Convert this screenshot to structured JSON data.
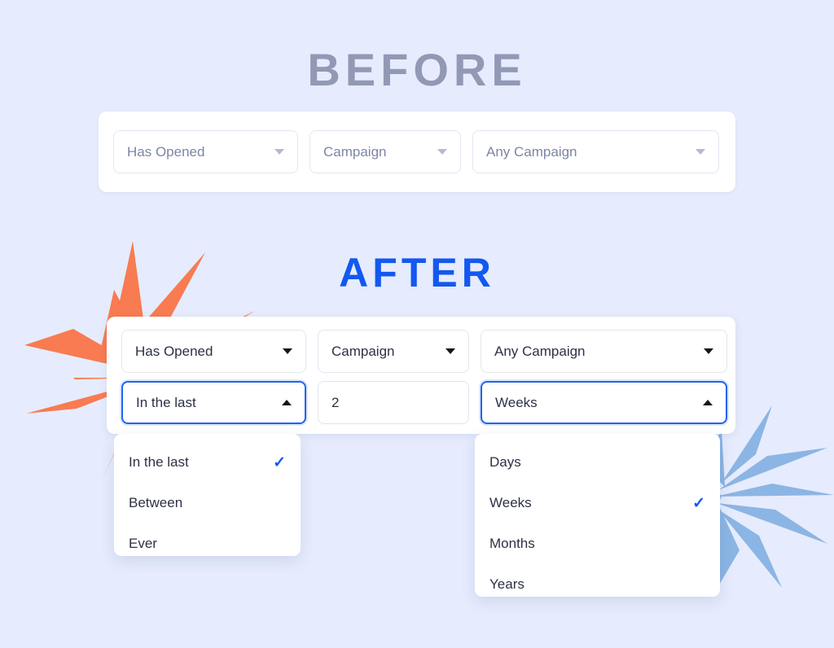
{
  "theme": {
    "background": "#e6ecfd",
    "before_title_color": "#9299b5",
    "after_title_color": "#1358f0",
    "accent_blue": "#2065e8",
    "burst_orange": "#f87b52",
    "burst_blue": "#8bb5e4",
    "card_white": "#ffffff"
  },
  "before": {
    "title": "BEFORE",
    "fields": [
      {
        "name": "event-type-select",
        "value": "Has Opened",
        "caret": "chevron-down-icon"
      },
      {
        "name": "campaign-type-select",
        "value": "Campaign",
        "caret": "chevron-down-icon"
      },
      {
        "name": "campaign-select",
        "value": "Any Campaign",
        "caret": "chevron-down-icon"
      }
    ]
  },
  "after": {
    "title": "AFTER",
    "row1": [
      {
        "name": "event-type-select",
        "value": "Has Opened",
        "caret": "chevron-down-icon"
      },
      {
        "name": "campaign-type-select",
        "value": "Campaign",
        "caret": "chevron-down-icon"
      },
      {
        "name": "campaign-select",
        "value": "Any Campaign",
        "caret": "chevron-down-icon"
      }
    ],
    "row2": {
      "operator": {
        "name": "timeframe-operator-select",
        "value": "In the last",
        "caret": "chevron-up-icon"
      },
      "amount": {
        "name": "timeframe-amount-input",
        "value": "2",
        "placeholder": ""
      },
      "unit": {
        "name": "timeframe-unit-select",
        "value": "Weeks",
        "caret": "chevron-up-icon"
      }
    },
    "dropdown_operator": {
      "options": [
        {
          "label": "In the last",
          "selected": true
        },
        {
          "label": "Between",
          "selected": false
        },
        {
          "label": "Ever",
          "selected": false
        }
      ]
    },
    "dropdown_unit": {
      "options": [
        {
          "label": "Days",
          "selected": false
        },
        {
          "label": "Weeks",
          "selected": true
        },
        {
          "label": "Months",
          "selected": false
        },
        {
          "label": "Years",
          "selected": false
        }
      ]
    },
    "check_glyph": "✓"
  },
  "decorations": {
    "left_burst": "starburst-orange",
    "right_burst": "starburst-blue"
  }
}
